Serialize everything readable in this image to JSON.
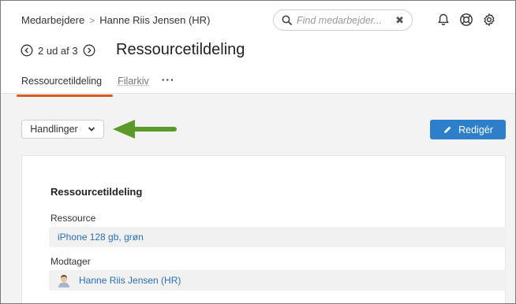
{
  "breadcrumb": {
    "root": "Medarbejdere",
    "current": "Hanne Riis Jensen (HR)"
  },
  "search": {
    "placeholder": "Find medarbejder..."
  },
  "pager": {
    "text": "2 ud af 3"
  },
  "page_title": "Ressourcetildeling",
  "tabs": [
    {
      "label": "Ressourcetildeling",
      "active": true
    },
    {
      "label": "Filarkiv",
      "active": false
    }
  ],
  "toolbar": {
    "actions_label": "Handlinger",
    "edit_label": "Redigér"
  },
  "card": {
    "title": "Ressourcetildeling",
    "resource_label": "Ressource",
    "resource_value": "iPhone 128 gb, grøn",
    "recipient_label": "Modtager",
    "recipient_value": "Hanne Riis Jensen (HR)"
  },
  "colors": {
    "accent_tab": "#d95a1c",
    "primary_button": "#2d7fc9",
    "arrow": "#5a9a2a",
    "link": "#2a6fb5"
  }
}
